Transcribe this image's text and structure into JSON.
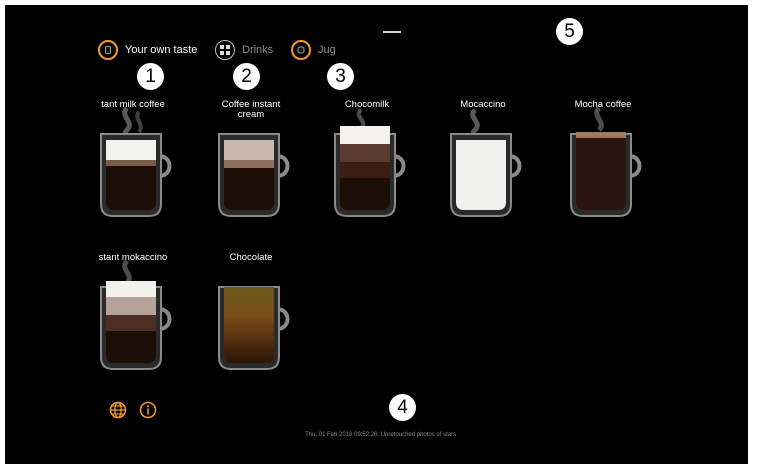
{
  "tabs": [
    {
      "label": "Your own taste",
      "icon": "cup-icon",
      "state": "active"
    },
    {
      "label": "Drinks",
      "icon": "drinks-grid-icon",
      "state": "inactive"
    },
    {
      "label": "Jug",
      "icon": "jug-icon",
      "state": "inactive"
    }
  ],
  "callouts": [
    "1",
    "2",
    "3",
    "4",
    "5"
  ],
  "drinks": [
    {
      "label": "tant milk coffee"
    },
    {
      "label": "Coffee instant",
      "label2": "cream"
    },
    {
      "label": "Chocomilk"
    },
    {
      "label": "Mocaccino"
    },
    {
      "label": "Mocha  coffee"
    },
    {
      "label": "stant mokaccino"
    },
    {
      "label": "Chocolate"
    }
  ],
  "footer": {
    "language_icon": "globe-icon",
    "info_icon": "info-icon",
    "status_text": "Thu, 01 Feb 2018 09:52:26:  Unretouched photos of stars"
  },
  "colors": {
    "accent": "#f19b2e",
    "background": "#000000",
    "callout_bg": "#ffffff",
    "label": "#ffffff"
  }
}
